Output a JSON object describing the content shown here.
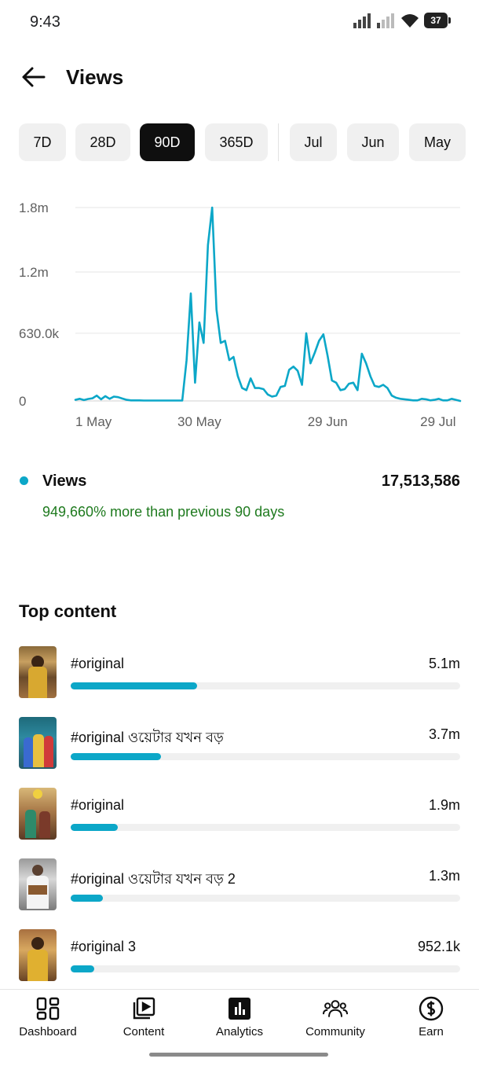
{
  "status_bar": {
    "time": "9:43",
    "battery": "37"
  },
  "header": {
    "title": "Views"
  },
  "chips": [
    {
      "label": "7D",
      "selected": false
    },
    {
      "label": "28D",
      "selected": false
    },
    {
      "label": "90D",
      "selected": true
    },
    {
      "label": "365D",
      "selected": false
    },
    {
      "label": "Jul",
      "selected": false
    },
    {
      "label": "Jun",
      "selected": false
    },
    {
      "label": "May",
      "selected": false
    }
  ],
  "chart_data": {
    "type": "line",
    "title": "",
    "xlabel": "",
    "ylabel": "",
    "y_ticks": [
      "0",
      "630.0k",
      "1.2m",
      "1.8m"
    ],
    "x_ticks": [
      "1 May",
      "30 May",
      "29 Jun",
      "29 Jul"
    ],
    "ylim": [
      0,
      1800000
    ],
    "grid": true,
    "color": "#0ca7c8",
    "series": [
      {
        "x": [
          "2024-05-01",
          "2024-05-02",
          "2024-05-03",
          "2024-05-04",
          "2024-05-05",
          "2024-05-06",
          "2024-05-07",
          "2024-05-08",
          "2024-05-09",
          "2024-05-10",
          "2024-05-11",
          "2024-05-12",
          "2024-05-13",
          "2024-05-14",
          "2024-05-15",
          "2024-05-16",
          "2024-05-17",
          "2024-05-18",
          "2024-05-19",
          "2024-05-20",
          "2024-05-21",
          "2024-05-22",
          "2024-05-23",
          "2024-05-24",
          "2024-05-25",
          "2024-05-26",
          "2024-05-27",
          "2024-05-28",
          "2024-05-29",
          "2024-05-30",
          "2024-05-31",
          "2024-06-01",
          "2024-06-02",
          "2024-06-03",
          "2024-06-04",
          "2024-06-05",
          "2024-06-06",
          "2024-06-07",
          "2024-06-08",
          "2024-06-09",
          "2024-06-10",
          "2024-06-11",
          "2024-06-12",
          "2024-06-13",
          "2024-06-14",
          "2024-06-15",
          "2024-06-16",
          "2024-06-17",
          "2024-06-18",
          "2024-06-19",
          "2024-06-20",
          "2024-06-21",
          "2024-06-22",
          "2024-06-23",
          "2024-06-24",
          "2024-06-25",
          "2024-06-26",
          "2024-06-27",
          "2024-06-28",
          "2024-06-29",
          "2024-06-30",
          "2024-07-01",
          "2024-07-02",
          "2024-07-03",
          "2024-07-04",
          "2024-07-05",
          "2024-07-06",
          "2024-07-07",
          "2024-07-08",
          "2024-07-09",
          "2024-07-10",
          "2024-07-11",
          "2024-07-12",
          "2024-07-13",
          "2024-07-14",
          "2024-07-15",
          "2024-07-16",
          "2024-07-17",
          "2024-07-18",
          "2024-07-19",
          "2024-07-20",
          "2024-07-21",
          "2024-07-22",
          "2024-07-23",
          "2024-07-24",
          "2024-07-25",
          "2024-07-26",
          "2024-07-27",
          "2024-07-28",
          "2024-07-29",
          "2024-07-30"
        ],
        "y": [
          10000,
          20000,
          8000,
          18000,
          25000,
          50000,
          15000,
          45000,
          20000,
          40000,
          35000,
          22000,
          10000,
          5000,
          5000,
          5000,
          4000,
          4000,
          4000,
          4000,
          4000,
          4000,
          4000,
          4000,
          4000,
          4000,
          380000,
          1000000,
          170000,
          730000,
          540000,
          1450000,
          1800000,
          850000,
          540000,
          560000,
          380000,
          410000,
          230000,
          120000,
          100000,
          210000,
          120000,
          120000,
          110000,
          60000,
          40000,
          50000,
          130000,
          140000,
          290000,
          320000,
          280000,
          150000,
          630000,
          350000,
          450000,
          560000,
          620000,
          420000,
          190000,
          170000,
          100000,
          110000,
          160000,
          170000,
          100000,
          440000,
          350000,
          230000,
          140000,
          130000,
          150000,
          120000,
          50000,
          30000,
          20000,
          15000,
          10000,
          5000,
          5000,
          20000,
          15000,
          5000,
          10000,
          20000,
          5000,
          5000,
          20000,
          10000,
          0
        ]
      }
    ]
  },
  "summary": {
    "label": "Views",
    "total": "17,513,586",
    "change_text": "949,660% more than previous 90 days"
  },
  "top_content": {
    "title": "Top content",
    "items": [
      {
        "title": "#original",
        "value": "5.1m",
        "fraction": 0.324
      },
      {
        "title": "#original  ওয়েটার যখন বড়",
        "value": "3.7m",
        "fraction": 0.232
      },
      {
        "title": "#original",
        "value": "1.9m",
        "fraction": 0.12
      },
      {
        "title": "#original  ওয়েটার যখন বড় 2",
        "value": "1.3m",
        "fraction": 0.082
      },
      {
        "title": "#original 3",
        "value": "952.1k",
        "fraction": 0.06
      }
    ]
  },
  "bottom_nav": [
    {
      "label": "Dashboard",
      "icon": "dashboard-icon"
    },
    {
      "label": "Content",
      "icon": "content-icon"
    },
    {
      "label": "Analytics",
      "icon": "analytics-icon"
    },
    {
      "label": "Community",
      "icon": "community-icon"
    },
    {
      "label": "Earn",
      "icon": "earn-icon"
    }
  ]
}
